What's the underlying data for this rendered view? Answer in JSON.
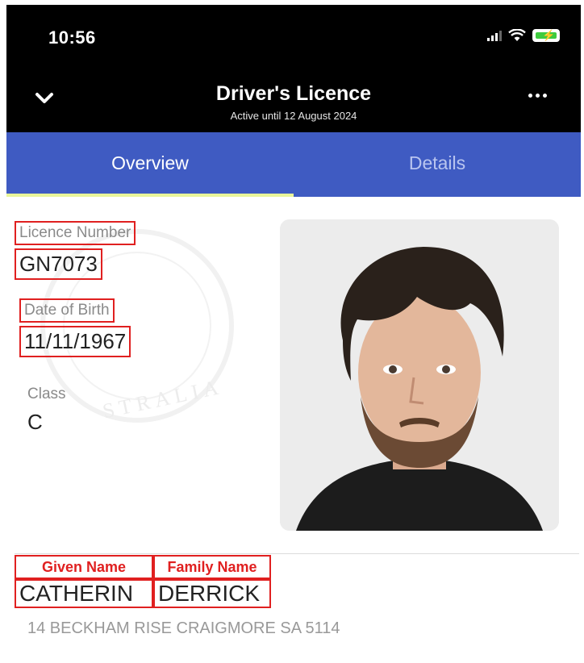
{
  "status_bar": {
    "time": "10:56"
  },
  "header": {
    "title": "Driver's Licence",
    "subtitle": "Active until 12 August 2024"
  },
  "tabs": [
    {
      "label": "Overview",
      "active": true
    },
    {
      "label": "Details",
      "active": false
    }
  ],
  "licence": {
    "number_label": "Licence Number",
    "number": "GN7073",
    "dob_label": "Date of Birth",
    "dob": "11/11/1967",
    "class_label": "Class",
    "class": "C",
    "given_name_label": "Given Name",
    "family_name_label": "Family Name",
    "given_name": "CATHERIN",
    "family_name": "DERRICK",
    "address": "14 BECKHAM RISE CRAIGMORE SA 5114"
  },
  "seal_text": "STRALIA",
  "colors": {
    "tab_bar": "#3f5bc2",
    "tab_indicator": "#e9f59a",
    "annotation": "#e02020"
  }
}
